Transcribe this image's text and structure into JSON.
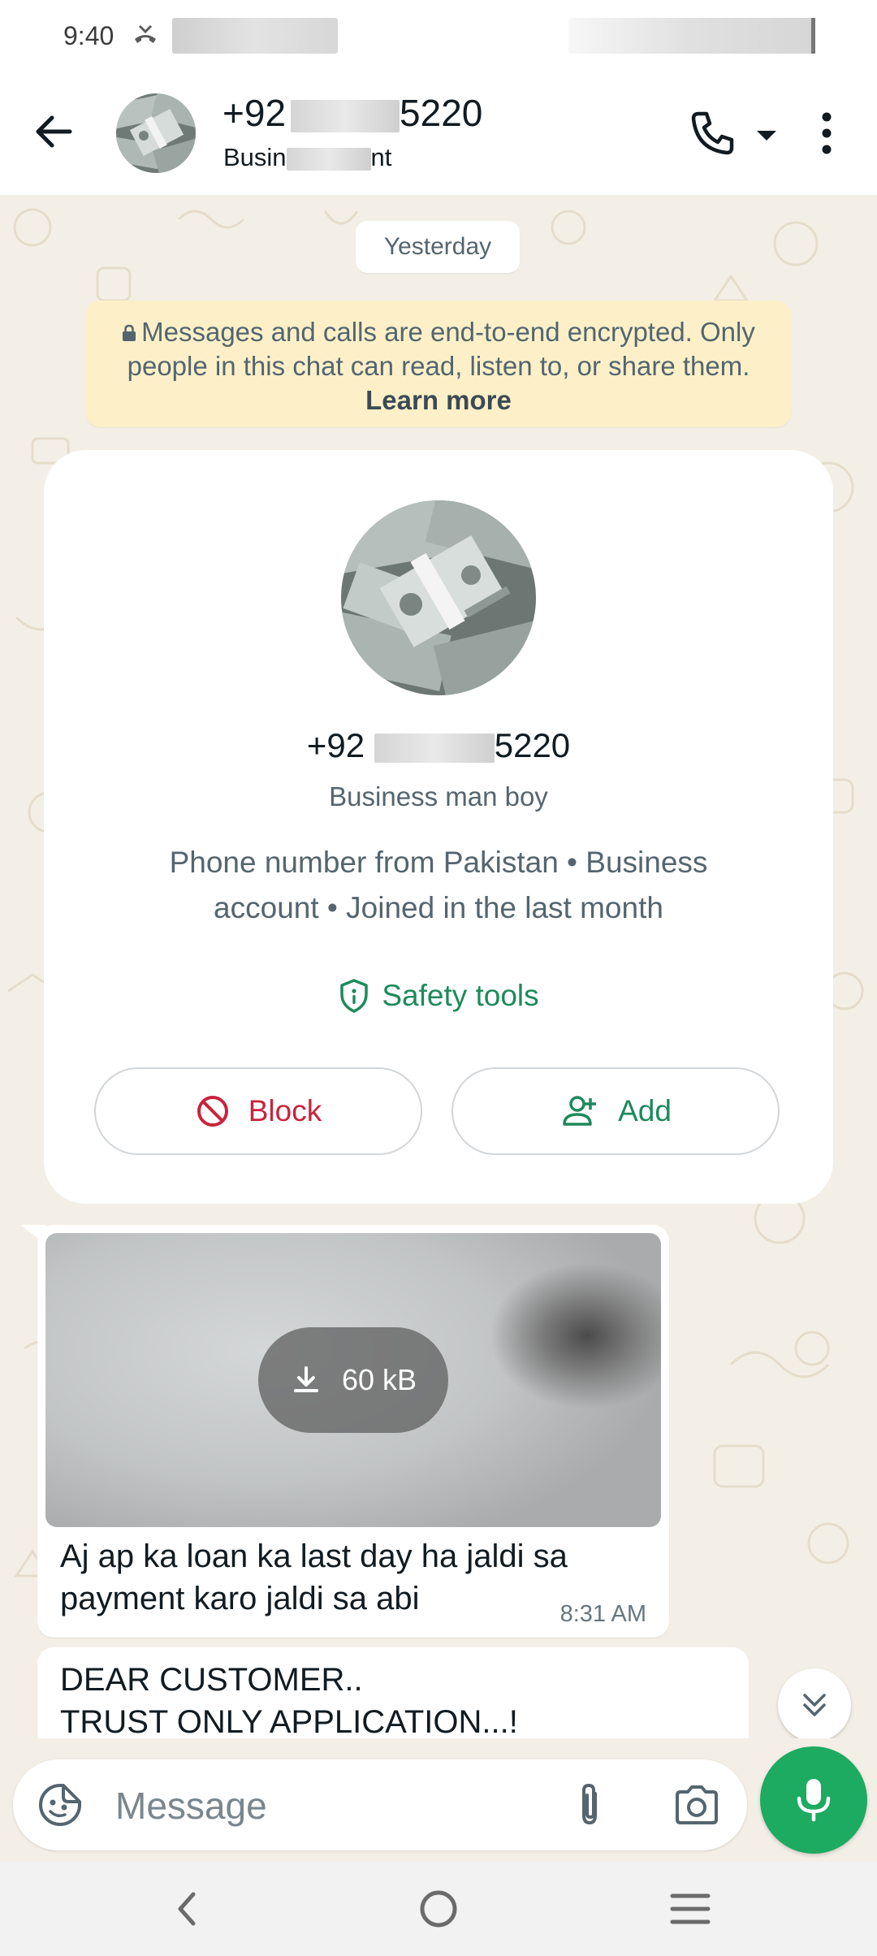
{
  "status_bar": {
    "time": "9:40"
  },
  "header": {
    "title_prefix": "+92",
    "title_suffix": "5220",
    "subtitle_prefix": "Busin",
    "subtitle_suffix": "nt",
    "icons": {
      "back": "back-arrow-icon",
      "call": "phone-icon",
      "call_dropdown": "dropdown-triangle-icon",
      "menu": "more-vertical-icon"
    }
  },
  "chat": {
    "date_chip": "Yesterday",
    "encryption_note": {
      "text": "Messages and calls are end-to-end encrypted. Only people in this chat can read, listen to, or share them.",
      "link": "Learn more"
    },
    "profile_card": {
      "phone_prefix": "+92",
      "phone_suffix": "5220",
      "name": "Business man boy",
      "description": "Phone number from Pakistan • Business account • Joined in the last month",
      "safety_tools": "Safety tools",
      "block_label": "Block",
      "add_label": "Add"
    },
    "messages": [
      {
        "type": "media",
        "download_size": "60 kB",
        "text": "Aj ap ka loan ka last day ha jaldi sa payment karo jaldi sa abi",
        "time": "8:31 AM"
      },
      {
        "type": "text",
        "line1": "DEAR CUSTOMER..",
        "line2": "TRUST ONLY APPLICATION...!"
      }
    ]
  },
  "composer": {
    "placeholder": "Message",
    "icons": {
      "emoji": "sticker-icon",
      "attach": "paperclip-icon",
      "camera": "camera-icon",
      "mic": "microphone-icon"
    }
  },
  "colors": {
    "accent_green": "#1daa61",
    "block_red": "#c8243d",
    "wallpaper": "#f4efe6",
    "encryption_bg": "#fdf0c8"
  }
}
